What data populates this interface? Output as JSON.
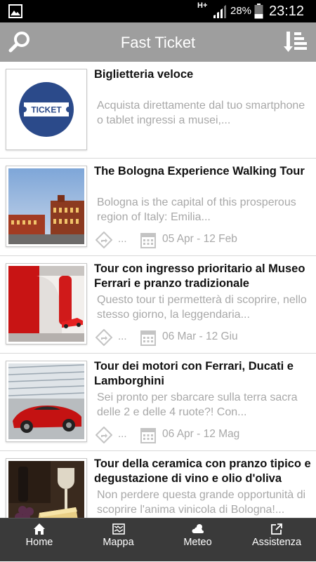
{
  "status_bar": {
    "network": "H+",
    "battery": "28%",
    "time": "23:12"
  },
  "app_bar": {
    "title": "Fast Ticket",
    "search_icon": "search-icon",
    "menu_icon": "list-menu-icon"
  },
  "items": [
    {
      "title": "Biglietteria veloce",
      "description": "Acquista direttamente dal tuo smartphone o tablet ingressi a musei,...",
      "thumbnail": "ticket-logo",
      "ticket_label": "TICKET"
    },
    {
      "title": "The Bologna Experience Walking Tour",
      "description": "Bologna is the capital of this prosperous region of Italy: Emilia...",
      "thumbnail": "bologna-square-photo",
      "share_dots": "...",
      "dates": "05 Apr - 12 Feb"
    },
    {
      "title": "Tour con ingresso prioritario al Museo Ferrari e pranzo tradizionale",
      "description": "Questo tour ti permetterà di scoprire, nello stesso giorno, la leggendaria...",
      "thumbnail": "ferrari-museum-photo",
      "share_dots": "...",
      "dates": "06 Mar - 12 Giu"
    },
    {
      "title": "Tour dei motori con Ferrari, Ducati e Lamborghini",
      "description": "Sei pronto per sbarcare sulla terra sacra delle 2 e delle 4 ruote?!  Con...",
      "thumbnail": "red-ferrari-photo",
      "share_dots": "...",
      "dates": "06 Apr - 12 Mag"
    },
    {
      "title": "Tour della ceramica con pranzo tipico e degustazione di vino e olio d'oliva",
      "description": "Non perdere questa grande opportunità di scoprire l'anima vinicola di Bologna!...",
      "thumbnail": "wine-cheese-photo"
    }
  ],
  "bottom_nav": [
    {
      "label": "Home",
      "icon": "home-icon"
    },
    {
      "label": "Mappa",
      "icon": "map-icon"
    },
    {
      "label": "Meteo",
      "icon": "weather-icon"
    },
    {
      "label": "Assistenza",
      "icon": "external-link-icon"
    }
  ],
  "colors": {
    "app_bar": "#9e9e9e",
    "status_bar": "#000000",
    "bottom_nav": "#3a3a3a",
    "ticket_blue": "#2b4a8a"
  }
}
